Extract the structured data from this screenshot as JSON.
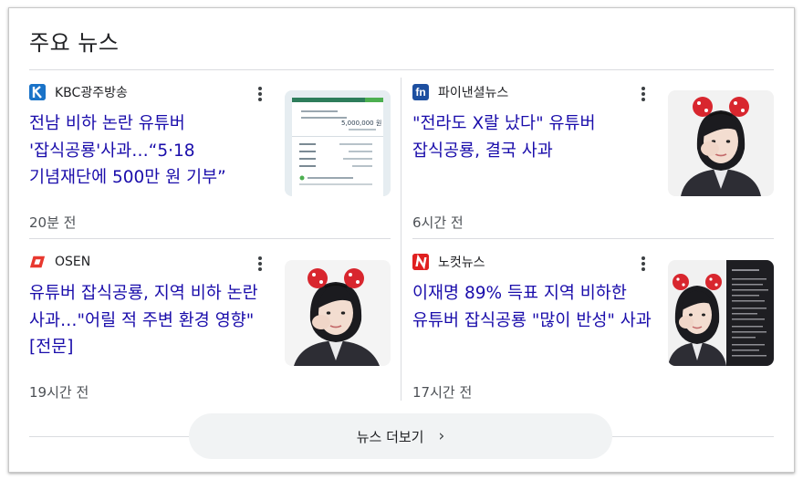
{
  "section": {
    "title": "주요 뉴스"
  },
  "articles": [
    {
      "source": "KBC광주방송",
      "logo_text": "K",
      "logo_color": "#1a73c8",
      "headline": "전남 비하 논란 유튜버 '잡식공룡'사과…“5·18 기념재단에 500만 원 기부”",
      "time": "20분 전",
      "thumb_amount": "5,000,000 원"
    },
    {
      "source": "파이낸셜뉴스",
      "logo_text": "fn",
      "logo_color": "#1d4fa0",
      "headline": "\"전라도 X랄 났다\" 유튜버 잡식공룡, 결국 사과",
      "time": "6시간 전"
    },
    {
      "source": "OSEN",
      "logo_text": "",
      "logo_color": "#e8382f",
      "headline": "유튜버 잡식공룡, 지역 비하 논란 사과…\"어릴 적 주변 환경 영향\" [전문]",
      "time": "19시간 전"
    },
    {
      "source": "노컷뉴스",
      "logo_text": "N",
      "logo_color": "#e02020",
      "headline": "이재명 89% 득표 지역 비하한 유튜버 잡식공룡 \"많이 반성\" 사과",
      "time": "17시간 전"
    }
  ],
  "footer": {
    "more_label": "뉴스 더보기"
  },
  "icons": {
    "more": "more-vert-icon",
    "chevron": "chevron-right-icon"
  }
}
